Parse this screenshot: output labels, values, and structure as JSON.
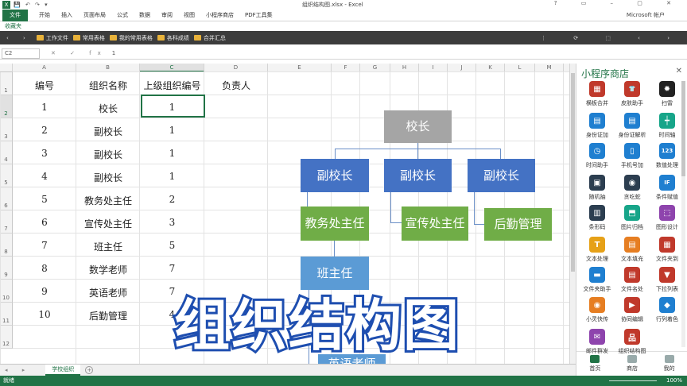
{
  "titlebar": {
    "app_icon": "X",
    "quick_access": "💾 ↶ ↷ ▾",
    "title": "组织结构图.xlsx - Excel",
    "controls": "? ▭ – ▢ ✕"
  },
  "ribbon": {
    "file": "文件",
    "tabs": [
      "开始",
      "插入",
      "页面布局",
      "公式",
      "数据",
      "审阅",
      "视图",
      "小程序商店",
      "PDF工具集"
    ],
    "account": "Microsoft 帐户"
  },
  "favorites": {
    "header": "收藏夹",
    "nav": "‹ ›",
    "items": [
      "工作文件",
      "常用表格",
      "我的常用表格",
      "各科成绩",
      "合并汇总"
    ],
    "right_icons": "⋮ ⟳ ⬚ ‹ ›"
  },
  "formula_bar": {
    "name_box": "C2",
    "fx": "✕ ✓ fx",
    "value": "1"
  },
  "columns": [
    "A",
    "B",
    "C",
    "D",
    "E",
    "F",
    "G",
    "H",
    "I",
    "J",
    "K",
    "L",
    "M",
    "N"
  ],
  "rows": [
    "1",
    "2",
    "3",
    "4",
    "5",
    "6",
    "7",
    "8",
    "9",
    "10",
    "11",
    "12"
  ],
  "headers": [
    "编号",
    "组织名称",
    "上级组织编号",
    "负责人"
  ],
  "table": [
    [
      "1",
      "校长",
      "1"
    ],
    [
      "2",
      "副校长",
      "1"
    ],
    [
      "3",
      "副校长",
      "1"
    ],
    [
      "4",
      "副校长",
      "1"
    ],
    [
      "5",
      "教务处主任",
      "2"
    ],
    [
      "6",
      "宣传处主任",
      "3"
    ],
    [
      "7",
      "班主任",
      "5"
    ],
    [
      "8",
      "数学老师",
      "7"
    ],
    [
      "9",
      "英语老师",
      "7"
    ],
    [
      "10",
      "后勤管理",
      "4"
    ]
  ],
  "org_chart": {
    "root": "校长",
    "level2": [
      "副校长",
      "副校长",
      "副校长"
    ],
    "level3": [
      "教务处主任",
      "宣传处主任",
      "后勤管理"
    ],
    "level4": [
      "班主任"
    ],
    "level5_partial": "英语老师",
    "colors": {
      "gray": "#a5a5a5",
      "blue": "#4472c4",
      "green": "#70ad47",
      "light_blue": "#5b9bd5"
    }
  },
  "sheet": {
    "tab": "学校组织"
  },
  "status": {
    "ready": "就绪",
    "zoom": "100%"
  },
  "panel": {
    "title": "小程序商店",
    "close": "✕",
    "items": [
      {
        "label": "横板合并",
        "icon": "grid-icon",
        "color": "#c0392b",
        "glyph": "▦"
      },
      {
        "label": "皮肤助手",
        "icon": "shirt-icon",
        "color": "#c0392b",
        "glyph": "👕"
      },
      {
        "label": "扫雷",
        "icon": "mine-icon",
        "color": "#222222",
        "glyph": "✹"
      },
      {
        "label": "身份证加",
        "icon": "id-card-icon",
        "color": "#1f7fd0",
        "glyph": "▤"
      },
      {
        "label": "身份证解析",
        "icon": "id-card-icon",
        "color": "#1f7fd0",
        "glyph": "▤"
      },
      {
        "label": "时间轴",
        "icon": "timeline-icon",
        "color": "#17a589",
        "glyph": "┿"
      },
      {
        "label": "时间助手",
        "icon": "clock-icon",
        "color": "#1f7fd0",
        "glyph": "◷"
      },
      {
        "label": "手机号加",
        "icon": "phone-icon",
        "color": "#1f7fd0",
        "glyph": "▯"
      },
      {
        "label": "数值处理",
        "icon": "number-icon",
        "color": "#1f7fd0",
        "glyph": "123"
      },
      {
        "label": "随机抽",
        "icon": "random-icon",
        "color": "#2c3e50",
        "glyph": "▣"
      },
      {
        "label": "贪吃蛇",
        "icon": "ghost-icon",
        "color": "#2c3e50",
        "glyph": "◉"
      },
      {
        "label": "条件赋值",
        "icon": "if-icon",
        "color": "#1f7fd0",
        "glyph": "IF"
      },
      {
        "label": "条形码",
        "icon": "barcode-icon",
        "color": "#2c3e50",
        "glyph": "▥"
      },
      {
        "label": "图片归档",
        "icon": "image-icon",
        "color": "#17a589",
        "glyph": "⬒"
      },
      {
        "label": "图形设计",
        "icon": "design-icon",
        "color": "#8e44ad",
        "glyph": "⬚"
      },
      {
        "label": "文本处理",
        "icon": "text-icon",
        "color": "#e6a118",
        "glyph": "T"
      },
      {
        "label": "文本填充",
        "icon": "fill-icon",
        "color": "#e67e22",
        "glyph": "▤"
      },
      {
        "label": "文件夹到",
        "icon": "folder-icon",
        "color": "#c0392b",
        "glyph": "▦"
      },
      {
        "label": "文件夹助手",
        "icon": "folder-icon",
        "color": "#1f7fd0",
        "glyph": "▬"
      },
      {
        "label": "文件名处",
        "icon": "file-icon",
        "color": "#c0392b",
        "glyph": "▤"
      },
      {
        "label": "下拉列表",
        "icon": "dropdown-icon",
        "color": "#c0392b",
        "glyph": "▼"
      },
      {
        "label": "小灵快传",
        "icon": "transfer-icon",
        "color": "#e67e22",
        "glyph": "◉"
      },
      {
        "label": "协同编辑",
        "icon": "edit-icon",
        "color": "#c0392b",
        "glyph": "▶"
      },
      {
        "label": "行列着色",
        "icon": "paint-icon",
        "color": "#1f7fd0",
        "glyph": "◆"
      },
      {
        "label": "邮件群发",
        "icon": "mail-icon",
        "color": "#8e44ad",
        "glyph": "✉"
      },
      {
        "label": "组织结构图",
        "icon": "org-chart-icon",
        "color": "#c0392b",
        "glyph": "品"
      }
    ],
    "nav": [
      "首页",
      "商店",
      "我的"
    ]
  },
  "overlay": {
    "text": "组织结构图"
  }
}
